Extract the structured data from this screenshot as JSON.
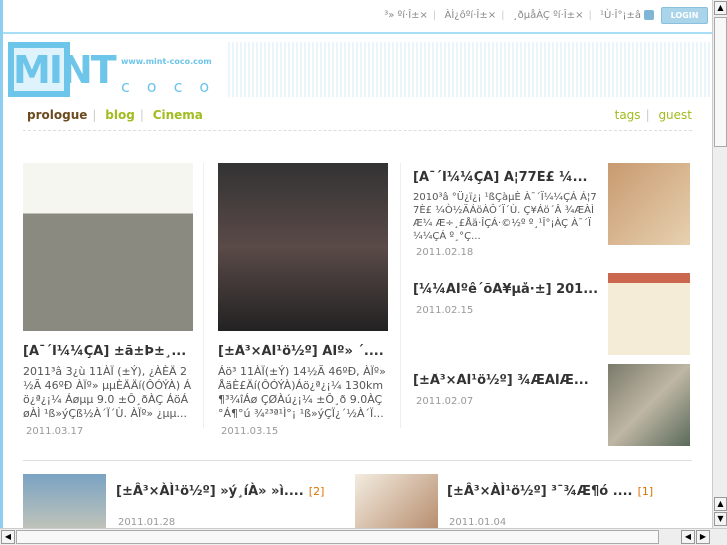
{
  "topbar": {
    "links": [
      "³» ºí·Î±×",
      "ÀÌ¿ôºí·Î±×",
      "¸ðµåÀÇ ºí·Î±×",
      "¹Ù·Î°¡±â"
    ],
    "login": "LOGIN"
  },
  "logo": {
    "mark": "MINT",
    "url": "www.mint-coco.com",
    "sub": "coco"
  },
  "nav": {
    "items": [
      "prologue",
      "blog",
      "Cinema"
    ],
    "right": [
      "tags",
      "guest"
    ]
  },
  "colors": {
    "accent": "#6ec5ea",
    "nav_active": "#6b4a1e",
    "nav": "#a0bc1e",
    "count": "#e07000"
  },
  "cards": [
    {
      "title": "[À¯´Ï¼¼ÇÁ] ±ã±Þ±¸...",
      "text": "2011³â 3¿ù 11ÀÏ (±Ý), ¿ÀÈÄ 2½Ã 46ºÐ ÀÏº» µµÈÄÄí(ÔÓÝÀ) Áö¿ª¿¡¼­ Áøµµ 9.0 ±Ô¸ðÀÇ ÁöÁøÀÌ ¹ß»ýÇß½À´Ï´Ù. ÀÏº» ¿µµ...",
      "date": "2011.03.17"
    },
    {
      "title": "[±Â³×ÀÌ¹ö½º] ÀÏº» ´....",
      "text": "Áö³­ 11ÀÏ(±Ý) 14½Ã 46ºÐ, ÀÏº» ÅäÈ£Äí(ÔÓÝÀ)Áö¿ª¿¡¼­ 130km ¶³¾îÁø ÇØÀú¿¡¼­ ±Ô¸ð 9.0ÀÇ °Á¶°ú ¾²³ª¹Ì°¡ ¹ß»ýÇÏ¿´½À´Ï...",
      "date": "2011.03.15"
    }
  ],
  "list": [
    {
      "title": "[À¯´Ï¼¼ÇÁ] Á¦77È£ ¼...",
      "text": "2010³â °Ü¿ï¿¡ ¹ßÇàµÈ À¯´Ï¼¼ÇÁ Á¦77È£ ¼Ò½ÄÁöÀÔ´Ï´Ù. Ç¥Áö´Â ¾ÆÀÌÆ¼ Æ÷¸£Åä·ÎÇÁ·©½º º¸¹Î°¡ÀÇ À¯´Ï¼¼ÇÁ º¸°Ç...",
      "date": "2011.02.18"
    },
    {
      "title": "[¼¼ÀÌºê´õÄ¥µå·±] 201...",
      "date": "2011.02.15"
    },
    {
      "title": "[±Â³×ÀÌ¹ö½º] ¾ÆÀÌÆ...",
      "date": "2011.02.07"
    }
  ],
  "bottom": [
    {
      "title": "[±Â³×ÀÌ¹ö½º] »ý¸íÀ» »ì....",
      "count": "[2]",
      "date": "2011.01.28"
    },
    {
      "title": "[±Â³×ÀÌ¹ö½º] ³¯¾Æ¶ó ....",
      "count": "[1]",
      "date": "2011.01.04"
    }
  ]
}
